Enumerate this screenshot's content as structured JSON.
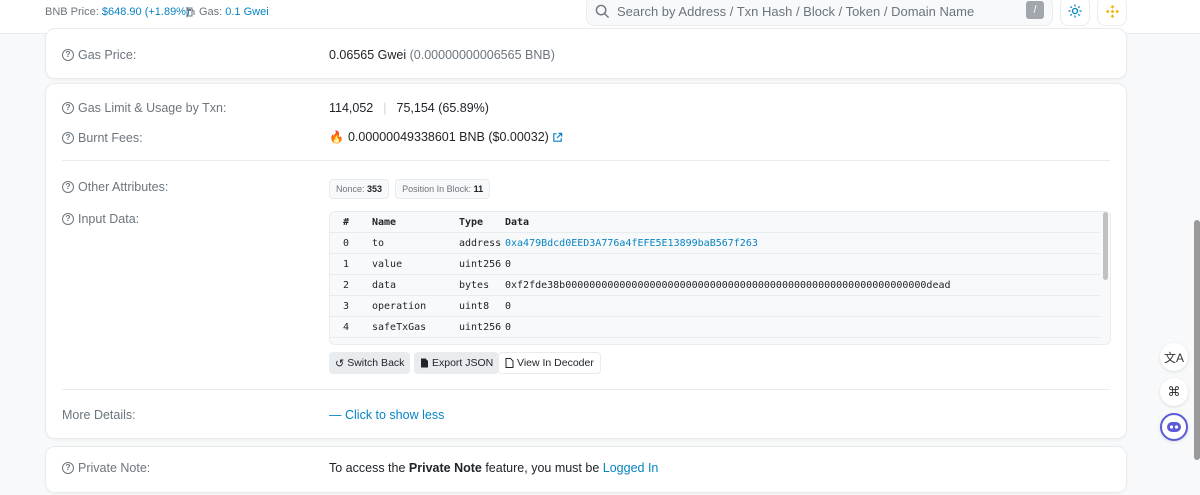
{
  "topbar": {
    "bnb_price_label": "BNB Price:",
    "bnb_price_value": "$648.90",
    "bnb_price_change": "(+1.89%)",
    "gas_label": "Gas:",
    "gas_value": "0.1 Gwei",
    "search_placeholder": "Search by Address / Txn Hash / Block / Token / Domain Name",
    "search_shortcut": "/"
  },
  "gas_price": {
    "label": "Gas Price:",
    "value": "0.06565 Gwei",
    "value_bnb": "(0.00000000006565 BNB)"
  },
  "gas_limit": {
    "label": "Gas Limit & Usage by Txn:",
    "limit": "114,052",
    "usage": "75,154 (65.89%)"
  },
  "burnt_fees": {
    "label": "Burnt Fees:",
    "value": "0.00000049338601 BNB ($0.00032)"
  },
  "other_attributes": {
    "label": "Other Attributes:",
    "nonce_label": "Nonce:",
    "nonce_value": "353",
    "position_label": "Position In Block:",
    "position_value": "11"
  },
  "input_data": {
    "label": "Input Data:",
    "headers": [
      "#",
      "Name",
      "Type",
      "Data"
    ],
    "rows": [
      {
        "idx": "0",
        "name": "to",
        "type": "address",
        "data": "0xa479Bdcd0EED3A776a4fEFE5E13899baB567f263",
        "is_link": true
      },
      {
        "idx": "1",
        "name": "value",
        "type": "uint256",
        "data": "0",
        "is_link": false
      },
      {
        "idx": "2",
        "name": "data",
        "type": "bytes",
        "data": "0xf2fde38b000000000000000000000000000000000000000000000000000000000000dead",
        "is_link": false
      },
      {
        "idx": "3",
        "name": "operation",
        "type": "uint8",
        "data": "0",
        "is_link": false
      },
      {
        "idx": "4",
        "name": "safeTxGas",
        "type": "uint256",
        "data": "0",
        "is_link": false
      }
    ],
    "buttons": {
      "switch_back": "Switch Back",
      "export_json": "Export JSON",
      "view_decoder": "View In Decoder"
    }
  },
  "more_details": {
    "label": "More Details:",
    "toggle": "Click to show less"
  },
  "private_note": {
    "label": "Private Note:",
    "text_before": "To access the ",
    "text_bold": "Private Note",
    "text_after": " feature, you must be ",
    "link": "Logged In"
  },
  "colors": {
    "accent": "#0784c3",
    "muted": "#6c757d",
    "border": "#e9ecef"
  },
  "icons": [
    "search-icon",
    "gas-pump-icon",
    "theme-toggle-icon",
    "bnb-logo-icon",
    "help-circle-icon",
    "fire-icon",
    "external-link-icon",
    "undo-icon",
    "document-icon",
    "translate-icon",
    "command-icon",
    "chatbot-icon"
  ]
}
